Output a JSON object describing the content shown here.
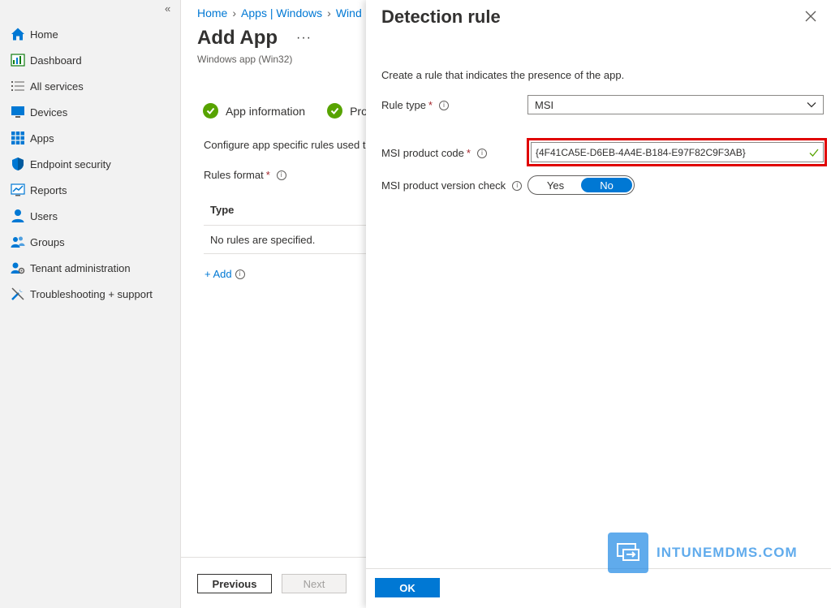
{
  "sidebar": {
    "collapse_label": "«",
    "items": [
      {
        "label": "Home",
        "icon": "home-icon"
      },
      {
        "label": "Dashboard",
        "icon": "dashboard-icon"
      },
      {
        "label": "All services",
        "icon": "list-icon"
      },
      {
        "label": "Devices",
        "icon": "devices-icon"
      },
      {
        "label": "Apps",
        "icon": "apps-icon"
      },
      {
        "label": "Endpoint security",
        "icon": "shield-icon"
      },
      {
        "label": "Reports",
        "icon": "reports-icon"
      },
      {
        "label": "Users",
        "icon": "user-icon"
      },
      {
        "label": "Groups",
        "icon": "groups-icon"
      },
      {
        "label": "Tenant administration",
        "icon": "tenant-admin-icon"
      },
      {
        "label": "Troubleshooting + support",
        "icon": "wrench-icon"
      }
    ]
  },
  "main": {
    "breadcrumb": [
      "Home",
      "Apps | Windows",
      "Wind"
    ],
    "title": "Add App",
    "more_label": "···",
    "subtitle": "Windows app (Win32)",
    "steps": [
      {
        "label": "App information",
        "status": "complete"
      },
      {
        "label": "Pro",
        "status": "complete"
      }
    ],
    "description": "Configure app specific rules used t",
    "rules_format_label": "Rules format",
    "required_mark": "*",
    "table": {
      "column": "Type",
      "empty_text": "No rules are specified."
    },
    "add_label": "+ Add",
    "previous_label": "Previous",
    "next_label": "Next"
  },
  "panel": {
    "title": "Detection rule",
    "description": "Create a rule that indicates the presence of the app.",
    "rule_type_label": "Rule type",
    "rule_type_value": "MSI",
    "product_code_label": "MSI product code",
    "product_code_value": "{4F41CA5E-D6EB-4A4E-B184-E97F82C9F3AB}",
    "version_check_label": "MSI product version check",
    "toggle": {
      "yes": "Yes",
      "no": "No",
      "selected": "No"
    },
    "ok_label": "OK"
  },
  "watermark": {
    "text": "INTUNEMDMS.COM"
  },
  "colors": {
    "accent": "#0078d4",
    "success": "#57a300",
    "required": "#a4262c",
    "highlight": "#e00000"
  }
}
